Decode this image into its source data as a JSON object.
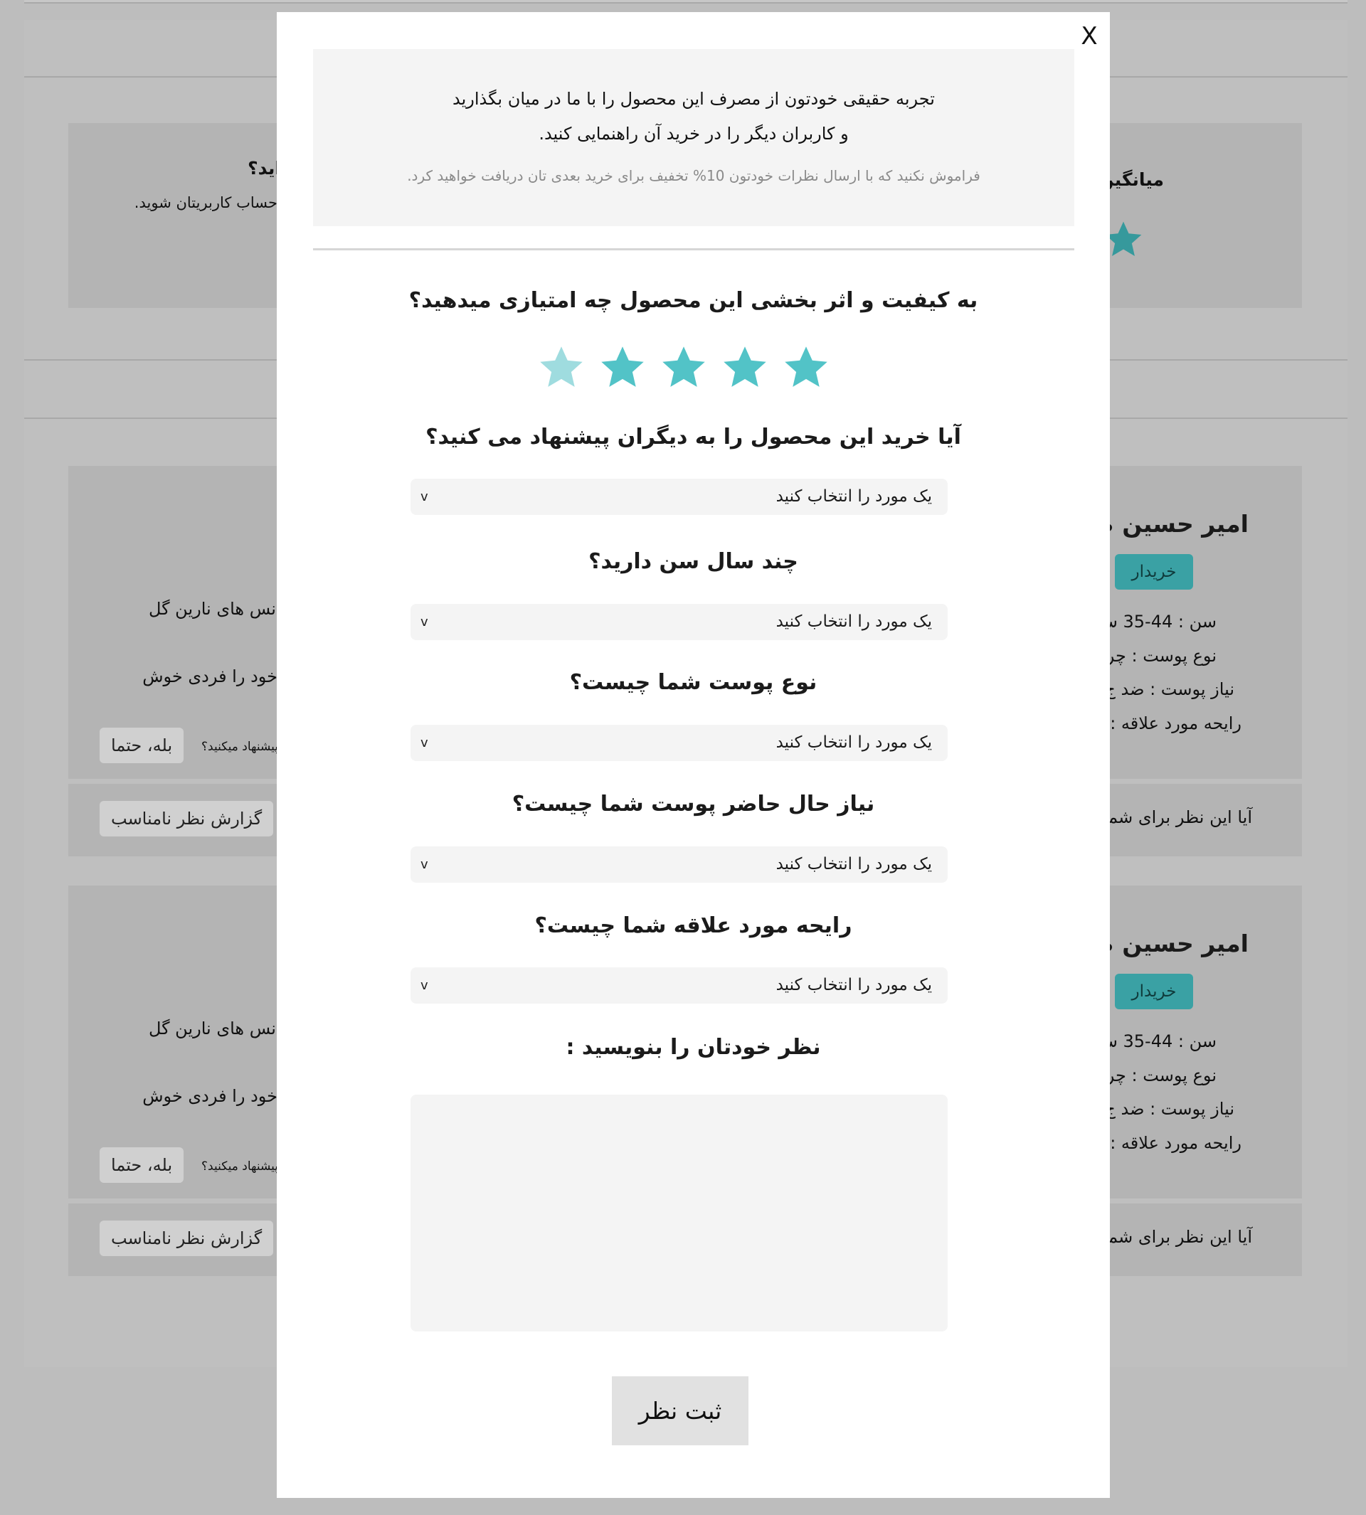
{
  "modal": {
    "close_label": "X",
    "intro_line1": "تجربه حقیقی خودتون از مصرف این محصول را با ما در میان بگذارید",
    "intro_line2": "و کاربران دیگر را در خرید آن راهنمایی کنید.",
    "intro_note": "فراموش نکنید که با ارسال نظرات خودتون 10% تخفیف برای خرید بعدی تان دریافت خواهید کرد.",
    "rating_question": "به کیفیت و اثر بخشی این محصول چه امتیازی میدهید؟",
    "rating": {
      "value": 4,
      "max": 5
    },
    "star_colors": {
      "filled": "#52c3c7",
      "empty": "#9fdcdf"
    },
    "recommend_question": "آیا خرید این محصول را به دیگران پیشنهاد می کنید؟",
    "recommend_select": "یک مورد را انتخاب کنید",
    "age_question": "چند سال سن دارید؟",
    "age_select": "یک مورد را انتخاب کنید",
    "skin_type_question": "نوع پوست شما چیست؟",
    "skin_type_select": "یک مورد را انتخاب کنید",
    "skin_need_question": "نیاز حال حاضر پوست شما چیست؟",
    "skin_need_select": "یک مورد را انتخاب کنید",
    "scent_question": "رایحه مورد علاقه شما چیست؟",
    "scent_select": "یک مورد را انتخاب کنید",
    "select_arrow": "v",
    "comment_label": "نظر خودتان را بنویسید :",
    "comment_value": "",
    "submit_label": "ثبت نظر"
  },
  "background": {
    "question_fragment": "اید؟",
    "account_fragment": "حساب کاربریتان شوید.",
    "average_fragment": "میانگین",
    "reviews": [
      {
        "name_fragment": "امیر حسین ص",
        "badge": "خریدار",
        "age_fragment": "سن : 44-35 س",
        "skin_type_fragment": "نوع پوست : چر",
        "skin_need_fragment": "نیاز پوست : ضد ج",
        "scent_fragment": "رایحه مورد علاقه : پ",
        "text_fragment1": "نس های نارین گل",
        "text_fragment2": "خود را فردی خوش",
        "recommend_fragment": "پیشنهاد میکنید؟",
        "recommend_answer": "بله، حتما",
        "helpful_fragment": "آیا این نظر برای شما",
        "report_label": "گزارش نظر نامناسب"
      },
      {
        "name_fragment": "امیر حسین ص",
        "badge": "خریدار",
        "age_fragment": "سن : 44-35 س",
        "skin_type_fragment": "نوع پوست : چر",
        "skin_need_fragment": "نیاز پوست : ضد ج",
        "scent_fragment": "رایحه مورد علاقه : پ",
        "text_fragment1": "نس های نارین گل",
        "text_fragment2": "خود را فردی خوش",
        "recommend_fragment": "پیشنهاد میکنید؟",
        "recommend_answer": "بله، حتما",
        "helpful_fragment": "آیا این نظر برای شما",
        "report_label": "گزارش نظر نامناسب"
      }
    ]
  }
}
